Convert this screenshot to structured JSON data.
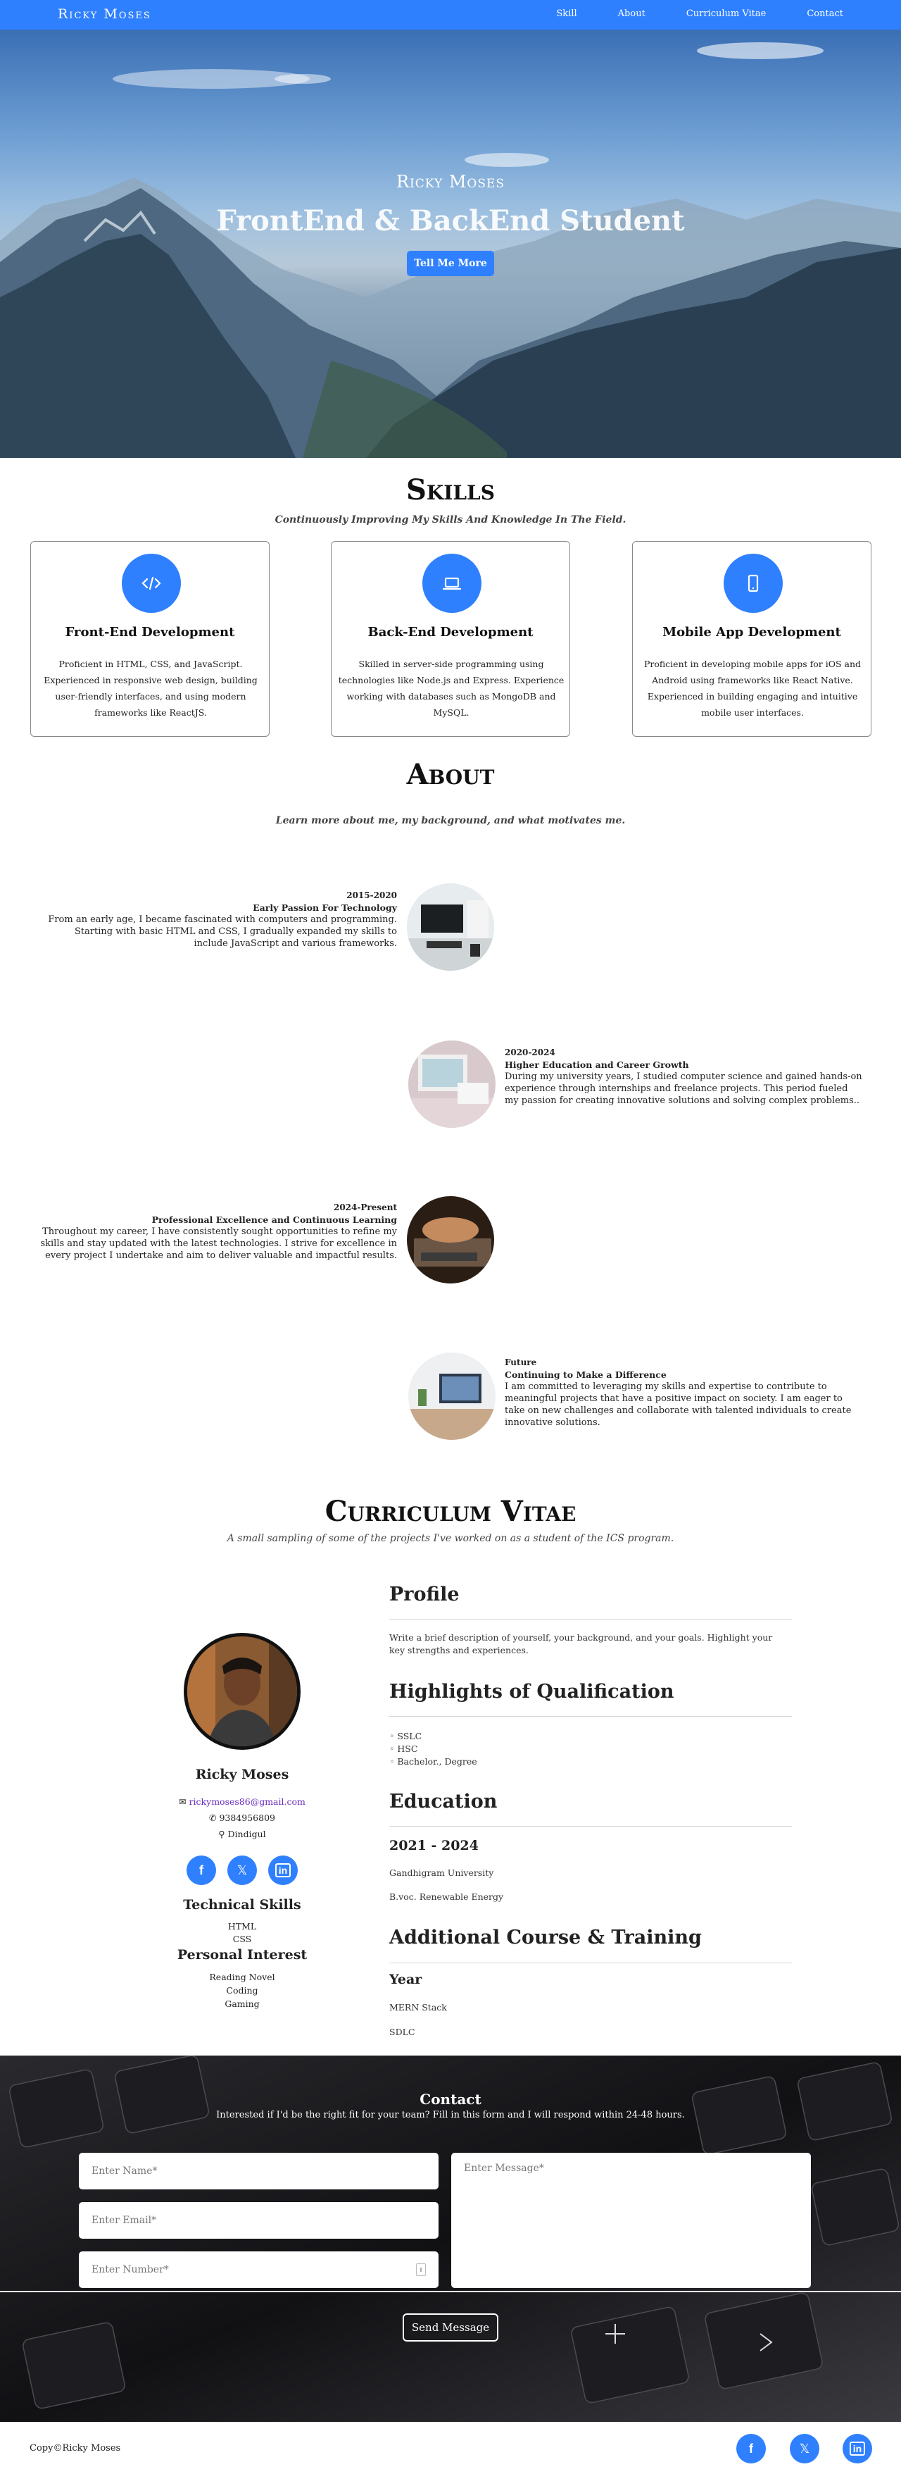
{
  "nav": {
    "brand": "Ricky Moses",
    "links": [
      "Skill",
      "About",
      "Curriculum Vitae",
      "Contact"
    ]
  },
  "hero": {
    "name": "Ricky Moses",
    "title": "FrontEnd & BackEnd Student",
    "button": "Tell Me More"
  },
  "skills": {
    "title": "Skills",
    "subtitle": "Continuously Improving My Skills And Knowledge In The Field.",
    "cards": [
      {
        "icon": "code-icon",
        "title": "Front-End Development",
        "text": "Proficient in HTML, CSS, and JavaScript. Experienced in responsive web design, building user-friendly interfaces, and using modern frameworks like ReactJS."
      },
      {
        "icon": "laptop-icon",
        "title": "Back-End Development",
        "text": "Skilled in server-side programming using technologies like Node.js and Express. Experience working with databases such as MongoDB and MySQL."
      },
      {
        "icon": "mobile-icon",
        "title": "Mobile App Development",
        "text": "Proficient in developing mobile apps for iOS and Android using frameworks like React Native. Experienced in building engaging and intuitive mobile user interfaces."
      }
    ]
  },
  "about": {
    "title": "About",
    "subtitle": "Learn more about me, my background, and what motivates me.",
    "items": [
      {
        "year": "2015-2020",
        "heading": "Early Passion For Technology",
        "text": "From an early age, I became fascinated with computers and programming. Starting with basic HTML and CSS, I gradually expanded my skills to include JavaScript and various frameworks."
      },
      {
        "year": "2020-2024",
        "heading": "Higher Education and Career Growth",
        "text": "During my university years, I studied computer science and gained hands-on experience through internships and freelance projects. This period fueled my passion for creating innovative solutions and solving complex problems.."
      },
      {
        "year": "2024-Present",
        "heading": "Professional Excellence and Continuous Learning",
        "text": "Throughout my career, I have consistently sought opportunities to refine my skills and stay updated with the latest technologies. I strive for excellence in every project I undertake and aim to deliver valuable and impactful results."
      },
      {
        "year": "Future",
        "heading": "Continuing to Make a Difference",
        "text": "I am committed to leveraging my skills and expertise to contribute to meaningful projects that have a positive impact on society. I am eager to take on new challenges and collaborate with talented individuals to create innovative solutions."
      }
    ]
  },
  "cv": {
    "title": "Curriculum Vitae",
    "subtitle": "A small sampling of some of the projects I've worked on as a student of the ICS program.",
    "name": "Ricky Moses",
    "email": "rickymoses86@gmail.com",
    "phone": "9384956809",
    "location": "Dindigul",
    "tech_title": "Technical Skills",
    "tech": [
      "HTML",
      "CSS"
    ],
    "interest_title": "Personal Interest",
    "interests": [
      "Reading Novel",
      "Coding",
      "Gaming"
    ],
    "profile_title": "Profile",
    "profile_text": "Write a brief description of yourself, your background, and your goals. Highlight your key strengths and experiences.",
    "qual_title": "Highlights of Qualification",
    "quals": [
      "SSLC",
      "HSC",
      "Bachelor., Degree"
    ],
    "edu_title": "Education",
    "edu_years": "2021 - 2024",
    "edu_school": "Gandhigram University",
    "edu_degree": "B.voc. Renewable Energy",
    "course_title": "Additional Course & Training",
    "course_year": "Year",
    "courses": [
      "MERN Stack",
      "SDLC"
    ]
  },
  "contact": {
    "title": "Contact",
    "subtitle": "Interested if I'd be the right fit for your team? Fill in this form and I will respond within 24-48 hours.",
    "name_ph": "Enter Name*",
    "email_ph": "Enter Email*",
    "number_ph": "Enter Number*",
    "message_ph": "Enter Message*",
    "send": "Send Message"
  },
  "footer": {
    "copy": "Copy©Ricky Moses"
  },
  "colors": {
    "accent": "#2f80ff"
  }
}
